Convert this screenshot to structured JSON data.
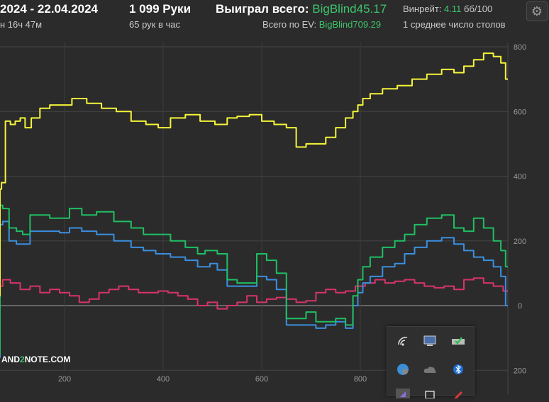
{
  "header": {
    "date_range": "2024 - 22.04.2024",
    "duration": "н 16ч 47м",
    "hands": "1 099 Руки",
    "hands_per_hour": "65 рук в час",
    "won_total_label": "Выиграл всего:",
    "won_total_value": "BigBlind45.17",
    "ev_total_label": "Всего по EV:",
    "ev_total_value": "BigBlind709.29",
    "winrate_label": "Винрейт:",
    "winrate_value": "4.11",
    "winrate_unit": "бб/100",
    "avg_tables": "1 среднее число столов"
  },
  "watermark": {
    "part1": "AND",
    "part2": "2",
    "part3": "NOTE.COM"
  },
  "tray": {
    "icons": [
      "wifi-icon",
      "monitor-icon",
      "check-drive-icon",
      "globe-icon",
      "cloud-icon",
      "bluetooth-icon",
      "arrow-icon",
      "window-icon",
      "red-icon"
    ]
  },
  "chart_data": {
    "type": "line",
    "title": "",
    "xlabel": "",
    "ylabel": "",
    "x_ticks": [
      200,
      400,
      600,
      800
    ],
    "y_ticks": [
      800,
      600,
      400,
      200,
      0,
      -200
    ],
    "xlim": [
      -65,
      1100
    ],
    "ylim": [
      -200,
      800
    ],
    "colors": {
      "yellow": "#f5f53a",
      "green": "#1fbf63",
      "blue": "#3b8fe0",
      "pink": "#d6336c"
    },
    "series": [
      {
        "color": "yellow",
        "x": [
          -65,
          -55,
          -45,
          -35,
          -25,
          -20,
          -15,
          -5,
          5,
          15,
          25,
          35,
          45,
          60,
          75,
          85,
          95,
          105,
          115,
          125,
          140,
          160,
          180,
          200,
          230,
          260,
          290,
          320,
          350,
          380,
          400,
          430,
          460,
          490,
          520,
          540,
          560,
          590,
          610,
          640,
          660,
          680,
          700,
          720,
          740,
          760,
          780,
          790,
          800,
          810,
          830,
          860,
          890,
          920,
          950,
          980,
          1000,
          1020,
          1040,
          1060,
          1080,
          1090,
          1100
        ],
        "y": [
          160,
          140,
          200,
          250,
          320,
          330,
          330,
          260,
          200,
          30,
          60,
          140,
          360,
          360,
          380,
          570,
          560,
          570,
          580,
          550,
          580,
          610,
          620,
          620,
          640,
          625,
          610,
          600,
          570,
          560,
          550,
          580,
          590,
          570,
          560,
          580,
          585,
          590,
          570,
          560,
          550,
          490,
          500,
          500,
          520,
          550,
          580,
          600,
          620,
          640,
          655,
          670,
          680,
          700,
          715,
          730,
          720,
          740,
          760,
          780,
          770,
          750,
          700
        ]
      },
      {
        "color": "green",
        "x": [
          -65,
          -60,
          -50,
          -40,
          -30,
          -25,
          -20,
          -10,
          0,
          5,
          10,
          15,
          20,
          30,
          40,
          50,
          55,
          65,
          80,
          95,
          110,
          120,
          140,
          160,
          180,
          200,
          220,
          250,
          280,
          320,
          350,
          370,
          400,
          430,
          460,
          480,
          490,
          500,
          520,
          540,
          560,
          580,
          600,
          620,
          640,
          660,
          680,
          700,
          720,
          740,
          760,
          780,
          790,
          800,
          810,
          830,
          860,
          880,
          900,
          920,
          950,
          980,
          1000,
          1020,
          1040,
          1060,
          1080,
          1090,
          1100
        ],
        "y": [
          200,
          190,
          150,
          180,
          250,
          230,
          300,
          280,
          210,
          30,
          -60,
          -60,
          -130,
          -60,
          -20,
          -150,
          30,
          310,
          300,
          240,
          230,
          220,
          280,
          280,
          270,
          270,
          300,
          280,
          290,
          260,
          240,
          220,
          220,
          200,
          180,
          160,
          170,
          170,
          160,
          80,
          70,
          70,
          160,
          140,
          100,
          -40,
          -40,
          -20,
          -50,
          -50,
          -40,
          -60,
          30,
          80,
          120,
          150,
          180,
          200,
          220,
          250,
          270,
          280,
          240,
          230,
          270,
          240,
          200,
          170,
          120
        ]
      },
      {
        "color": "blue",
        "x": [
          -65,
          -60,
          -50,
          -40,
          -30,
          -25,
          -20,
          -10,
          0,
          5,
          10,
          15,
          20,
          30,
          40,
          50,
          55,
          65,
          80,
          95,
          110,
          120,
          140,
          160,
          180,
          200,
          220,
          250,
          280,
          320,
          350,
          370,
          400,
          430,
          460,
          480,
          490,
          500,
          520,
          540,
          560,
          580,
          600,
          620,
          640,
          660,
          680,
          700,
          720,
          740,
          760,
          780,
          790,
          800,
          810,
          830,
          860,
          880,
          900,
          920,
          950,
          980,
          1000,
          1020,
          1040,
          1060,
          1080,
          1090,
          1100
        ],
        "y": [
          180,
          170,
          130,
          150,
          210,
          200,
          230,
          220,
          180,
          20,
          -80,
          -80,
          -150,
          -80,
          -50,
          -160,
          0,
          250,
          260,
          200,
          190,
          190,
          230,
          230,
          230,
          225,
          240,
          230,
          220,
          200,
          180,
          170,
          160,
          150,
          140,
          120,
          120,
          130,
          110,
          60,
          60,
          60,
          90,
          80,
          50,
          -60,
          -60,
          -60,
          -70,
          -60,
          -50,
          -70,
          0,
          40,
          70,
          90,
          120,
          130,
          160,
          180,
          200,
          210,
          190,
          170,
          150,
          140,
          120,
          90,
          0
        ]
      },
      {
        "color": "pink",
        "x": [
          -65,
          -40,
          -20,
          0,
          20,
          40,
          60,
          80,
          100,
          120,
          140,
          160,
          180,
          200,
          220,
          240,
          260,
          280,
          300,
          320,
          340,
          360,
          380,
          400,
          420,
          440,
          460,
          480,
          500,
          520,
          540,
          560,
          580,
          600,
          620,
          640,
          660,
          680,
          700,
          720,
          740,
          760,
          780,
          800,
          820,
          840,
          860,
          880,
          900,
          920,
          940,
          960,
          980,
          1000,
          1020,
          1040,
          1060,
          1080,
          1100
        ],
        "y": [
          35,
          30,
          40,
          45,
          70,
          60,
          60,
          80,
          70,
          50,
          60,
          40,
          50,
          40,
          30,
          10,
          20,
          40,
          50,
          60,
          50,
          40,
          40,
          45,
          40,
          30,
          20,
          0,
          10,
          -10,
          0,
          10,
          30,
          10,
          20,
          25,
          20,
          10,
          15,
          40,
          50,
          40,
          45,
          60,
          70,
          80,
          70,
          75,
          80,
          70,
          60,
          55,
          60,
          50,
          80,
          85,
          70,
          60,
          45
        ]
      }
    ]
  }
}
